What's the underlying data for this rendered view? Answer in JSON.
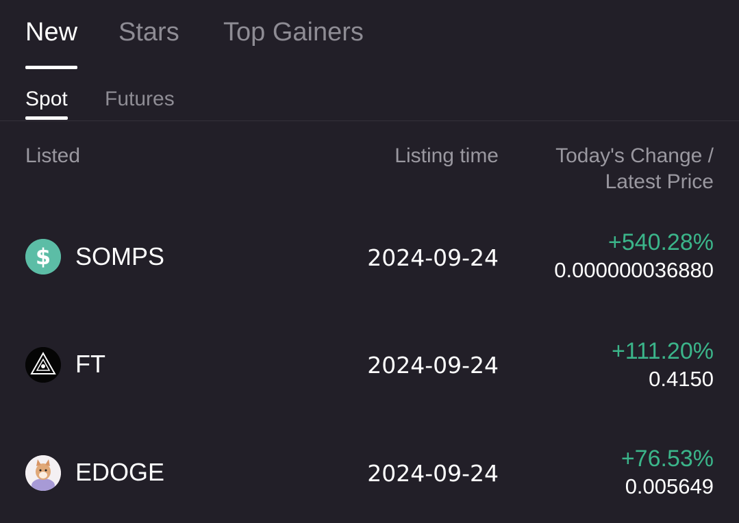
{
  "tabs": {
    "primary": [
      {
        "label": "New",
        "active": true
      },
      {
        "label": "Stars",
        "active": false
      },
      {
        "label": "Top Gainers",
        "active": false
      }
    ],
    "secondary": [
      {
        "label": "Spot",
        "active": true
      },
      {
        "label": "Futures",
        "active": false
      }
    ]
  },
  "table": {
    "headers": {
      "listed": "Listed",
      "listing_time": "Listing time",
      "change_line1": "Today's Change /",
      "change_line2": "Latest Price"
    },
    "rows": [
      {
        "symbol": "SOMPS",
        "icon": "dollar-coin-icon",
        "listing_time": "2024-09-24",
        "change": "+540.28%",
        "price": "0.000000036880"
      },
      {
        "symbol": "FT",
        "icon": "fractal-triangle-icon",
        "listing_time": "2024-09-24",
        "change": "+111.20%",
        "price": "0.4150"
      },
      {
        "symbol": "EDOGE",
        "icon": "doge-avatar-icon",
        "listing_time": "2024-09-24",
        "change": "+76.53%",
        "price": "0.005649"
      }
    ]
  },
  "colors": {
    "background": "#221f28",
    "positive": "#3bb58a",
    "inactive_text": "#8e8c94"
  }
}
